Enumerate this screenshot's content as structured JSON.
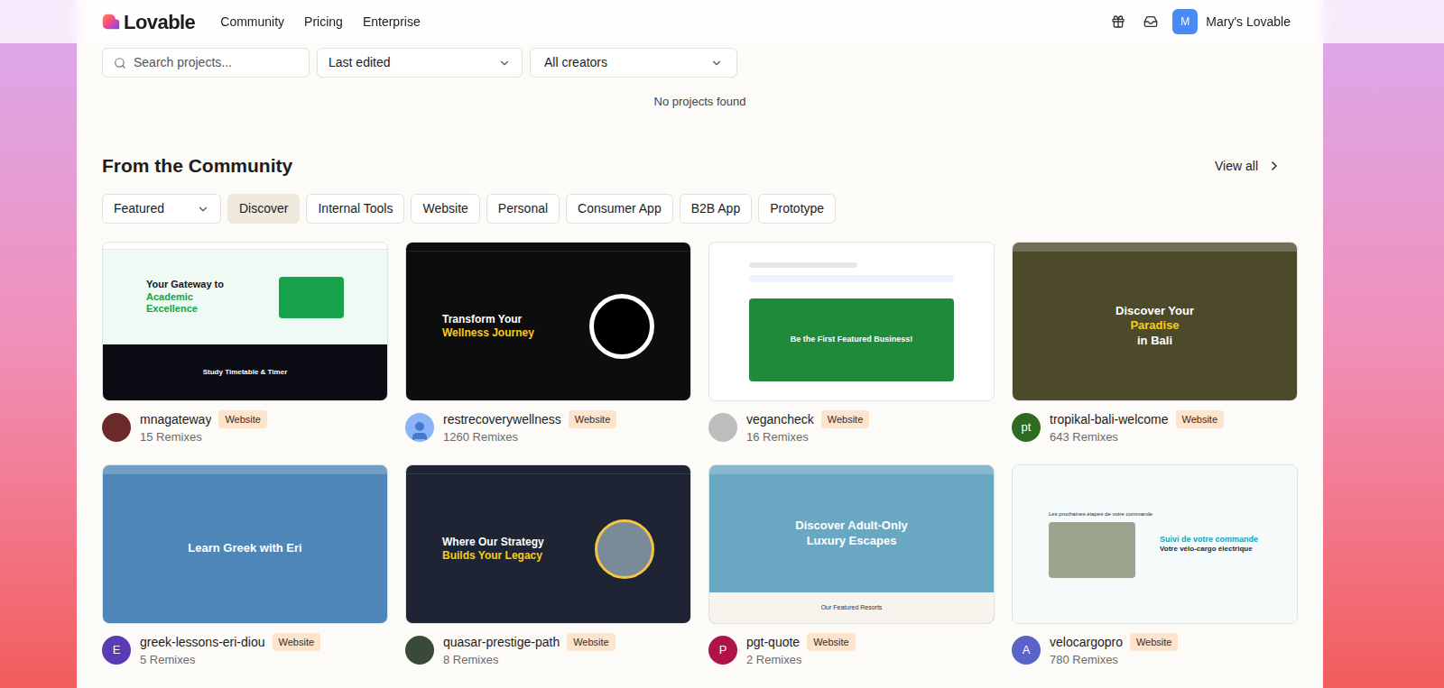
{
  "header": {
    "logo": "Lovable",
    "nav": [
      "Community",
      "Pricing",
      "Enterprise"
    ],
    "user": {
      "initial": "M",
      "name": "Mary's Lovable"
    }
  },
  "projects": {
    "search": {
      "placeholder": "Search projects..."
    },
    "sort": "Last edited",
    "creators": "All creators",
    "empty": "No projects found"
  },
  "community": {
    "title": "From the Community",
    "view_all": "View all",
    "select": "Featured",
    "filters": [
      {
        "label": "Discover",
        "selected": true
      },
      {
        "label": "Internal Tools",
        "selected": false
      },
      {
        "label": "Website",
        "selected": false
      },
      {
        "label": "Personal",
        "selected": false
      },
      {
        "label": "Consumer App",
        "selected": false
      },
      {
        "label": "B2B App",
        "selected": false
      },
      {
        "label": "Prototype",
        "selected": false
      }
    ],
    "cards": [
      {
        "name": "mnagateway",
        "badge": "Website",
        "remixes": "15 Remixes",
        "avatar": {
          "kind": "photo",
          "color": "#6b2a2a"
        },
        "preview": {
          "kind": "split",
          "bg": "#eefaf3",
          "text": "#111827",
          "accent": "#16a34a",
          "headline": "Your Gateway to",
          "highlight": "Academic Excellence",
          "sub": "Study Timetable & Timer"
        }
      },
      {
        "name": "restrecoverywellness",
        "badge": "Website",
        "remixes": "1260 Remixes",
        "avatar": {
          "kind": "default",
          "color": "#8ab4f8"
        },
        "preview": {
          "kind": "hero-left",
          "bg": "#0d0d0d",
          "text": "#ffffff",
          "accent": "#facc15",
          "headline": "Transform Your",
          "highlight": "Wellness Journey",
          "figure": "ring"
        }
      },
      {
        "name": "vegancheck",
        "badge": "Website",
        "remixes": "16 Remixes",
        "avatar": {
          "kind": "photo",
          "color": "#bdbdbd"
        },
        "preview": {
          "kind": "panel",
          "bg": "#ffffff",
          "text": "#ffffff",
          "accent": "#1f8a3a",
          "headline": "Be the First Featured Business!"
        }
      },
      {
        "name": "tropikal-bali-welcome",
        "badge": "Website",
        "remixes": "643 Remixes",
        "avatar": {
          "kind": "letter",
          "text": "pt",
          "color": "#2e6b21"
        },
        "preview": {
          "kind": "hero-center",
          "bg": "#4d4a2c",
          "text": "#ffffff",
          "accent": "#facc15",
          "headline": "Discover Your",
          "highlight": "Paradise",
          "tail": "in Bali"
        }
      },
      {
        "name": "greek-lessons-eri-diou",
        "badge": "Website",
        "remixes": "5 Remixes",
        "avatar": {
          "kind": "letter",
          "text": "E",
          "color": "#5b3bb5"
        },
        "preview": {
          "kind": "hero-center",
          "bg": "#4f86b8",
          "text": "#ffffff",
          "accent": "#ffffff",
          "headline": "Learn Greek with Eri"
        }
      },
      {
        "name": "quasar-prestige-path",
        "badge": "Website",
        "remixes": "8 Remixes",
        "avatar": {
          "kind": "photo",
          "color": "#3a4a3a"
        },
        "preview": {
          "kind": "hero-left",
          "bg": "#1e2433",
          "text": "#ffffff",
          "accent": "#facc15",
          "headline": "Where Our Strategy",
          "highlight": "Builds Your Legacy",
          "figure": "photo"
        }
      },
      {
        "name": "pgt-quote",
        "badge": "Website",
        "remixes": "2 Remixes",
        "avatar": {
          "kind": "letter",
          "text": "P",
          "color": "#b0124a"
        },
        "preview": {
          "kind": "hero-center",
          "bg": "#6aa7c2",
          "text": "#ffffff",
          "accent": "#ffffff",
          "headline": "Discover Adult-Only",
          "highlight": "Luxury Escapes",
          "sub": "Our Featured Resorts"
        }
      },
      {
        "name": "velocargopro",
        "badge": "Website",
        "remixes": "780 Remixes",
        "avatar": {
          "kind": "letter",
          "text": "A",
          "color": "#5a63c8"
        },
        "preview": {
          "kind": "tracker",
          "bg": "#f5fafb",
          "text": "#1f2937",
          "accent": "#14a3b8",
          "headline": "Suivi de votre commande",
          "highlight": "Votre vélo-cargo électrique",
          "sub": "Les prochaines étapes de votre commande"
        }
      }
    ]
  }
}
